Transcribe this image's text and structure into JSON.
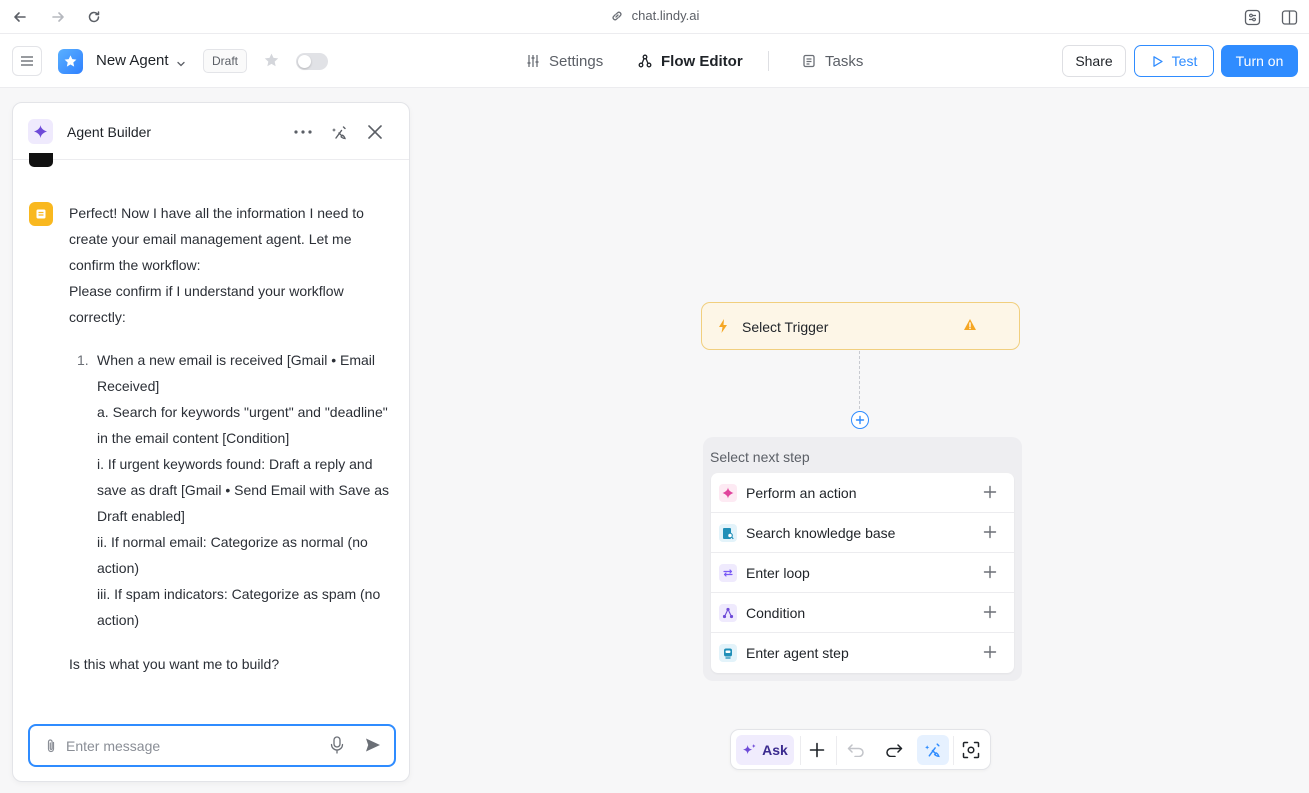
{
  "browser": {
    "url": "chat.lindy.ai"
  },
  "header": {
    "agent_name": "New Agent",
    "status_badge": "Draft",
    "tabs": [
      {
        "label": "Settings"
      },
      {
        "label": "Flow Editor"
      },
      {
        "label": "Tasks"
      }
    ],
    "active_tab": "Flow Editor",
    "share_label": "Share",
    "test_label": "Test",
    "turn_on_label": "Turn on",
    "accent_color": "#2f8cff"
  },
  "builder": {
    "title": "Agent Builder",
    "message": {
      "intro": "Perfect! Now I have all the information I need to create your email management agent. Let me confirm the workflow:",
      "question": "Please confirm if I understand your workflow correctly:",
      "steps": [
        {
          "number": "1.",
          "lines": [
            "When a new email is received [Gmail • Email Received]",
            "a. Search for keywords \"urgent\" and \"deadline\" in the email content [Condition]",
            "i. If urgent keywords found: Draft a reply and save as draft [Gmail • Send Email with Save as Draft enabled]",
            "ii. If normal email: Categorize as normal (no action)",
            "iii. If spam indicators: Categorize as spam (no action)"
          ]
        }
      ],
      "closing": "Is this what you want me to build?"
    },
    "input": {
      "placeholder": "Enter message",
      "value": ""
    }
  },
  "flow": {
    "trigger": {
      "label": "Select Trigger",
      "status": "warning"
    },
    "next_step": {
      "heading": "Select next step",
      "options": [
        {
          "label": "Perform an action",
          "icon": "sparkle-action-icon",
          "color": "#e0449c"
        },
        {
          "label": "Search knowledge base",
          "icon": "knowledge-base-icon",
          "color": "#1f8fb8"
        },
        {
          "label": "Enter loop",
          "icon": "loop-icon",
          "color": "#7a5af5"
        },
        {
          "label": "Condition",
          "icon": "condition-icon",
          "color": "#6e4bd8"
        },
        {
          "label": "Enter agent step",
          "icon": "agent-step-icon",
          "color": "#1f8fb8"
        }
      ]
    }
  },
  "toolbar": {
    "ask_label": "Ask"
  }
}
